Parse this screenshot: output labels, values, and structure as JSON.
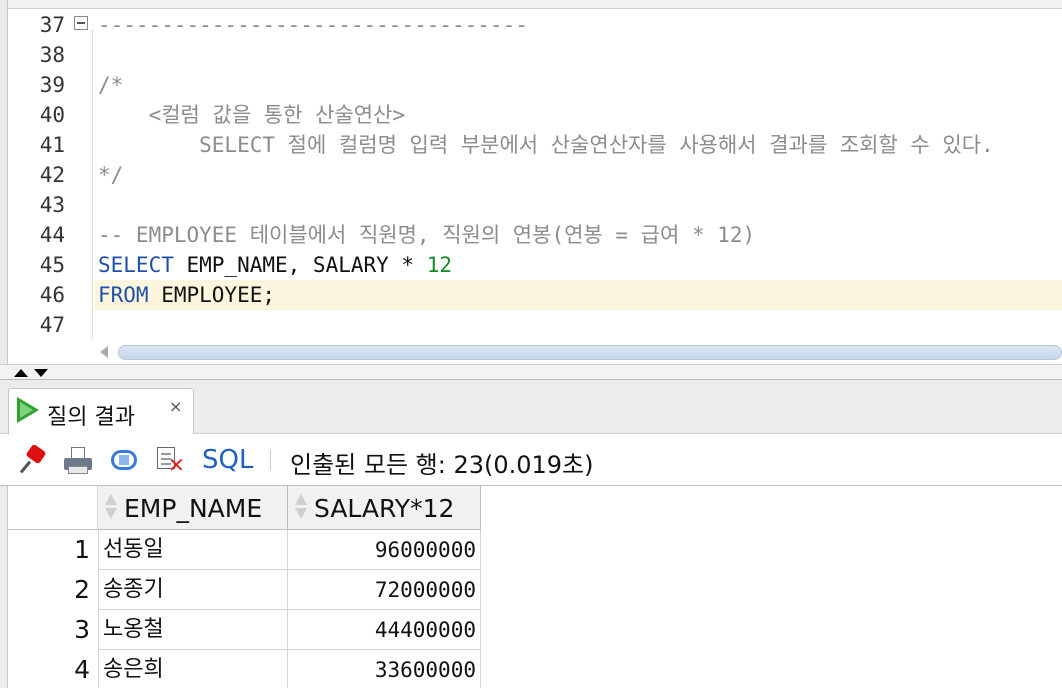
{
  "editor": {
    "line_numbers": [
      "37",
      "38",
      "39",
      "40",
      "41",
      "42",
      "43",
      "44",
      "45",
      "46",
      "47"
    ],
    "lines": {
      "l37": "----------------------------------",
      "l39": "/*",
      "l40": "    <컬럼 값을 통한 산술연산>",
      "l41": "        SELECT 절에 컬럼명 입력 부분에서 산술연산자를 사용해서 결과를 조회할 수 있다.",
      "l42": "*/",
      "l44": "-- EMPLOYEE 테이블에서 직원명, 직원의 연봉(연봉 = 급여 * 12)",
      "l45_kw": "SELECT",
      "l45_text": " EMP_NAME, SALARY * ",
      "l45_num": "12",
      "l46_kw": "FROM",
      "l46_text": " EMPLOYEE;"
    },
    "current_line": 46
  },
  "results": {
    "tab_label": "질의 결과",
    "tab_close": "×",
    "toolbar": {
      "sql_label": "SQL",
      "status": "인출된 모든 행: 23(0.019초)"
    },
    "columns": [
      "EMP_NAME",
      "SALARY*12"
    ],
    "rows": [
      {
        "num": "1",
        "name": "선동일",
        "salary": "96000000"
      },
      {
        "num": "2",
        "name": "송종기",
        "salary": "72000000"
      },
      {
        "num": "3",
        "name": "노옹철",
        "salary": "44400000"
      },
      {
        "num": "4",
        "name": "송은희",
        "salary": "33600000"
      }
    ]
  },
  "colors": {
    "keyword": "#1f4fa8",
    "number": "#178a27",
    "comment": "#8c8c8c",
    "current_line": "#fdf6df",
    "link": "#1f5fc0"
  },
  "icons": [
    "fold-minus-icon",
    "play-icon",
    "pin-icon",
    "print-icon",
    "refresh-icon",
    "cancel-icon",
    "sort-icon"
  ]
}
